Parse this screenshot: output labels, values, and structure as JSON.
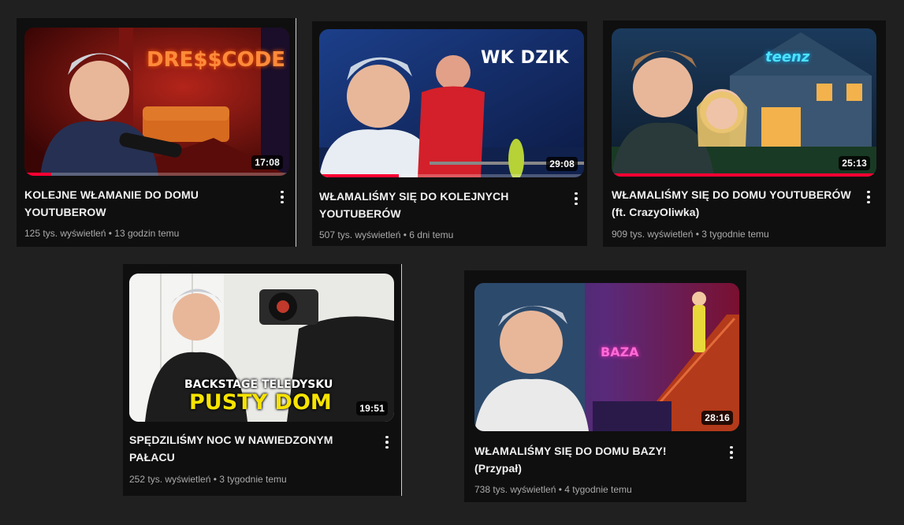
{
  "videos": [
    {
      "title_line1": "KOLEJNE WŁAMANIE DO DOMU",
      "title_line2": "YOUTUBEROW",
      "views": "125 tys. wyświetleń",
      "age": "13 godzin temu",
      "duration": "17:08",
      "thumb_text": "DRE$$CODE",
      "watch_progress": 0.1
    },
    {
      "title_line1": "WŁAMALIŚMY SIĘ DO KOLEJNYCH",
      "title_line2": "YOUTUBERÓW",
      "views": "507 tys. wyświetleń",
      "age": "6 dni temu",
      "duration": "29:08",
      "thumb_text": "WK DZIK",
      "watch_progress": 0.3
    },
    {
      "title_line1": "WŁAMALIŚMY SIĘ DO DOMU YOUTUBERÓW",
      "title_line2": "(ft. CrazyOliwka)",
      "views": "909 tys. wyświetleń",
      "age": "3 tygodnie temu",
      "duration": "25:13",
      "thumb_text": "teenz",
      "watch_progress": 1.0
    },
    {
      "title_line1": "SPĘDZILIŚMY NOC W NAWIEDZONYM",
      "title_line2": "PAŁACU",
      "views": "252 tys. wyświetleń",
      "age": "3 tygodnie temu",
      "duration": "19:51",
      "thumb_text_top": "BACKSTAGE TELEDYSKU",
      "thumb_text_bottom": "PUSTY DOM"
    },
    {
      "title_line1": "WŁAMALIŚMY SIĘ DO DOMU BAZY!",
      "title_line2": "(Przypał)",
      "views": "738 tys. wyświetleń",
      "age": "4 tygodnie temu",
      "duration": "28:16",
      "thumb_text": "BAZA"
    }
  ],
  "separator": "•",
  "icons": {
    "more": "vertical-dots-icon"
  },
  "colors": {
    "background": "#202020",
    "card": "#0f0f0f",
    "progress": "#ff0033"
  }
}
